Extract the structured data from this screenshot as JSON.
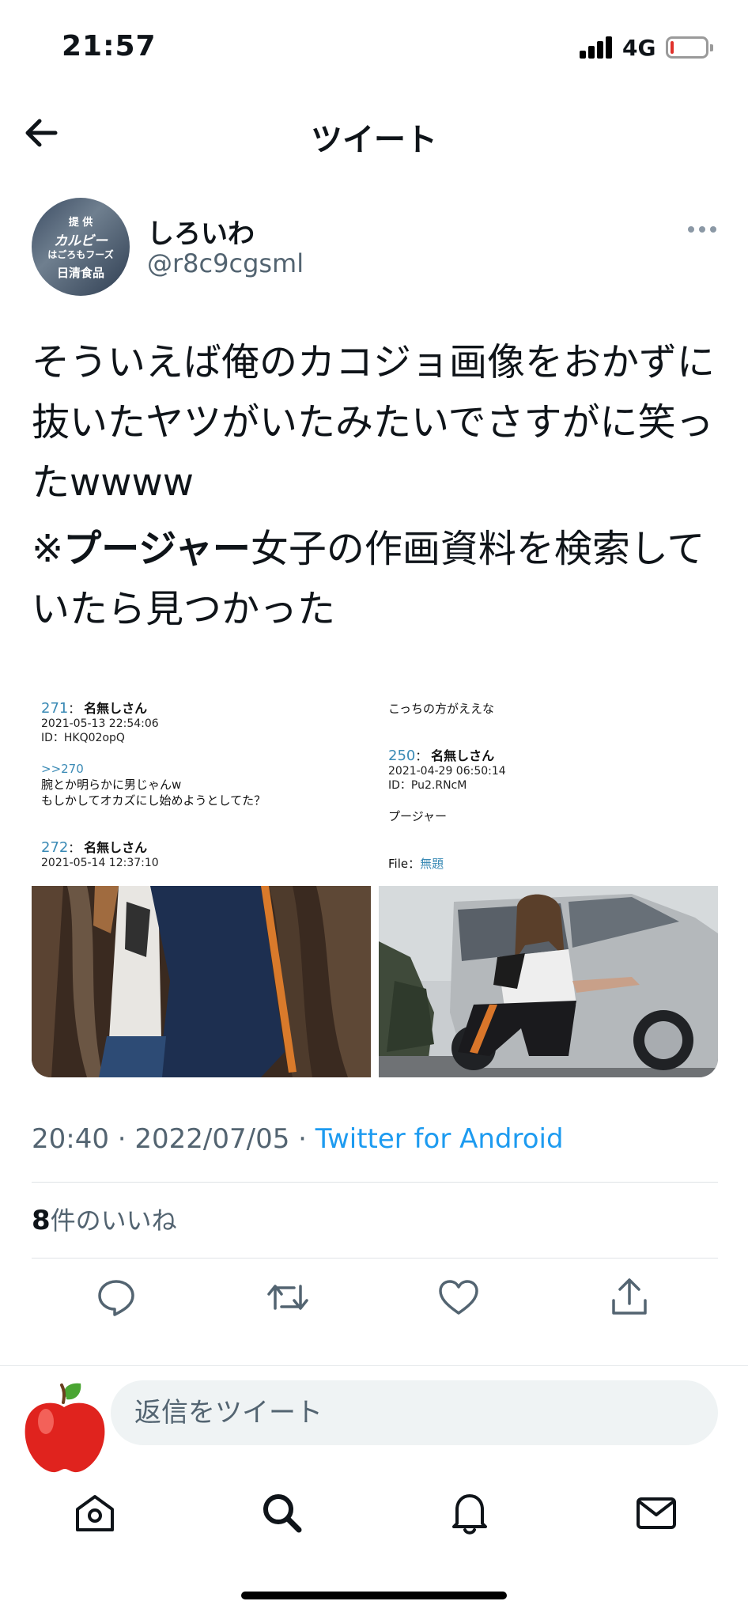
{
  "status_bar": {
    "time": "21:57",
    "network": "4G",
    "battery_color": "#e0312b"
  },
  "header": {
    "title": "ツイート"
  },
  "tweet": {
    "author": {
      "name": "しろいわ",
      "handle": "@r8c9cgsml",
      "avatar_text": [
        "提 供",
        "カルビー",
        "はごろもフーズ",
        "日清食品"
      ]
    },
    "text_line1": "そういえば俺のカコジョ画像をおかずに抜いたヤツがいたみたいでさすがに笑ったwwww",
    "text_prefix": "※",
    "text_bold": "プージャー",
    "text_rest": "女子の作画資料を検索していたら見つかった",
    "media": {
      "left": {
        "post1_num": "271",
        "post1_name": "名無しさん",
        "post1_date": "2021-05-13 22:54:06",
        "post1_id": "ID：HKQ02opQ",
        "post1_anchor": ">>270",
        "post1_line1": "腕とか明らかに男じゃんw",
        "post1_line2": "もしかしてオカズにし始めようとしてた？",
        "post2_num": "272",
        "post2_name": "名無しさん",
        "post2_date": "2021-05-14 12:37:10"
      },
      "right": {
        "top_text": "こっちの方がええな",
        "post_num": "250",
        "post_name": "名無しさん",
        "post_date": "2021-04-29 06:50:14",
        "post_id": "ID：Pu2.RNcM",
        "post_body": "プージャー",
        "file_label": "File：",
        "file_link": "無題"
      }
    },
    "timestamp": "20:40 · 2022/07/05 · ",
    "source": "Twitter for Android",
    "likes_count": "8",
    "likes_label": "件のいいね"
  },
  "reply": {
    "placeholder": "返信をツイート"
  },
  "colors": {
    "accent": "#1d9bf0",
    "secondary_text": "#536471",
    "primary_text": "#0f1419"
  },
  "icons": {
    "header": "back-arrow-icon",
    "actions": [
      "reply-icon",
      "retweet-icon",
      "like-icon",
      "share-icon"
    ],
    "tabs": [
      "home-icon",
      "search-icon",
      "notifications-icon",
      "messages-icon"
    ]
  }
}
